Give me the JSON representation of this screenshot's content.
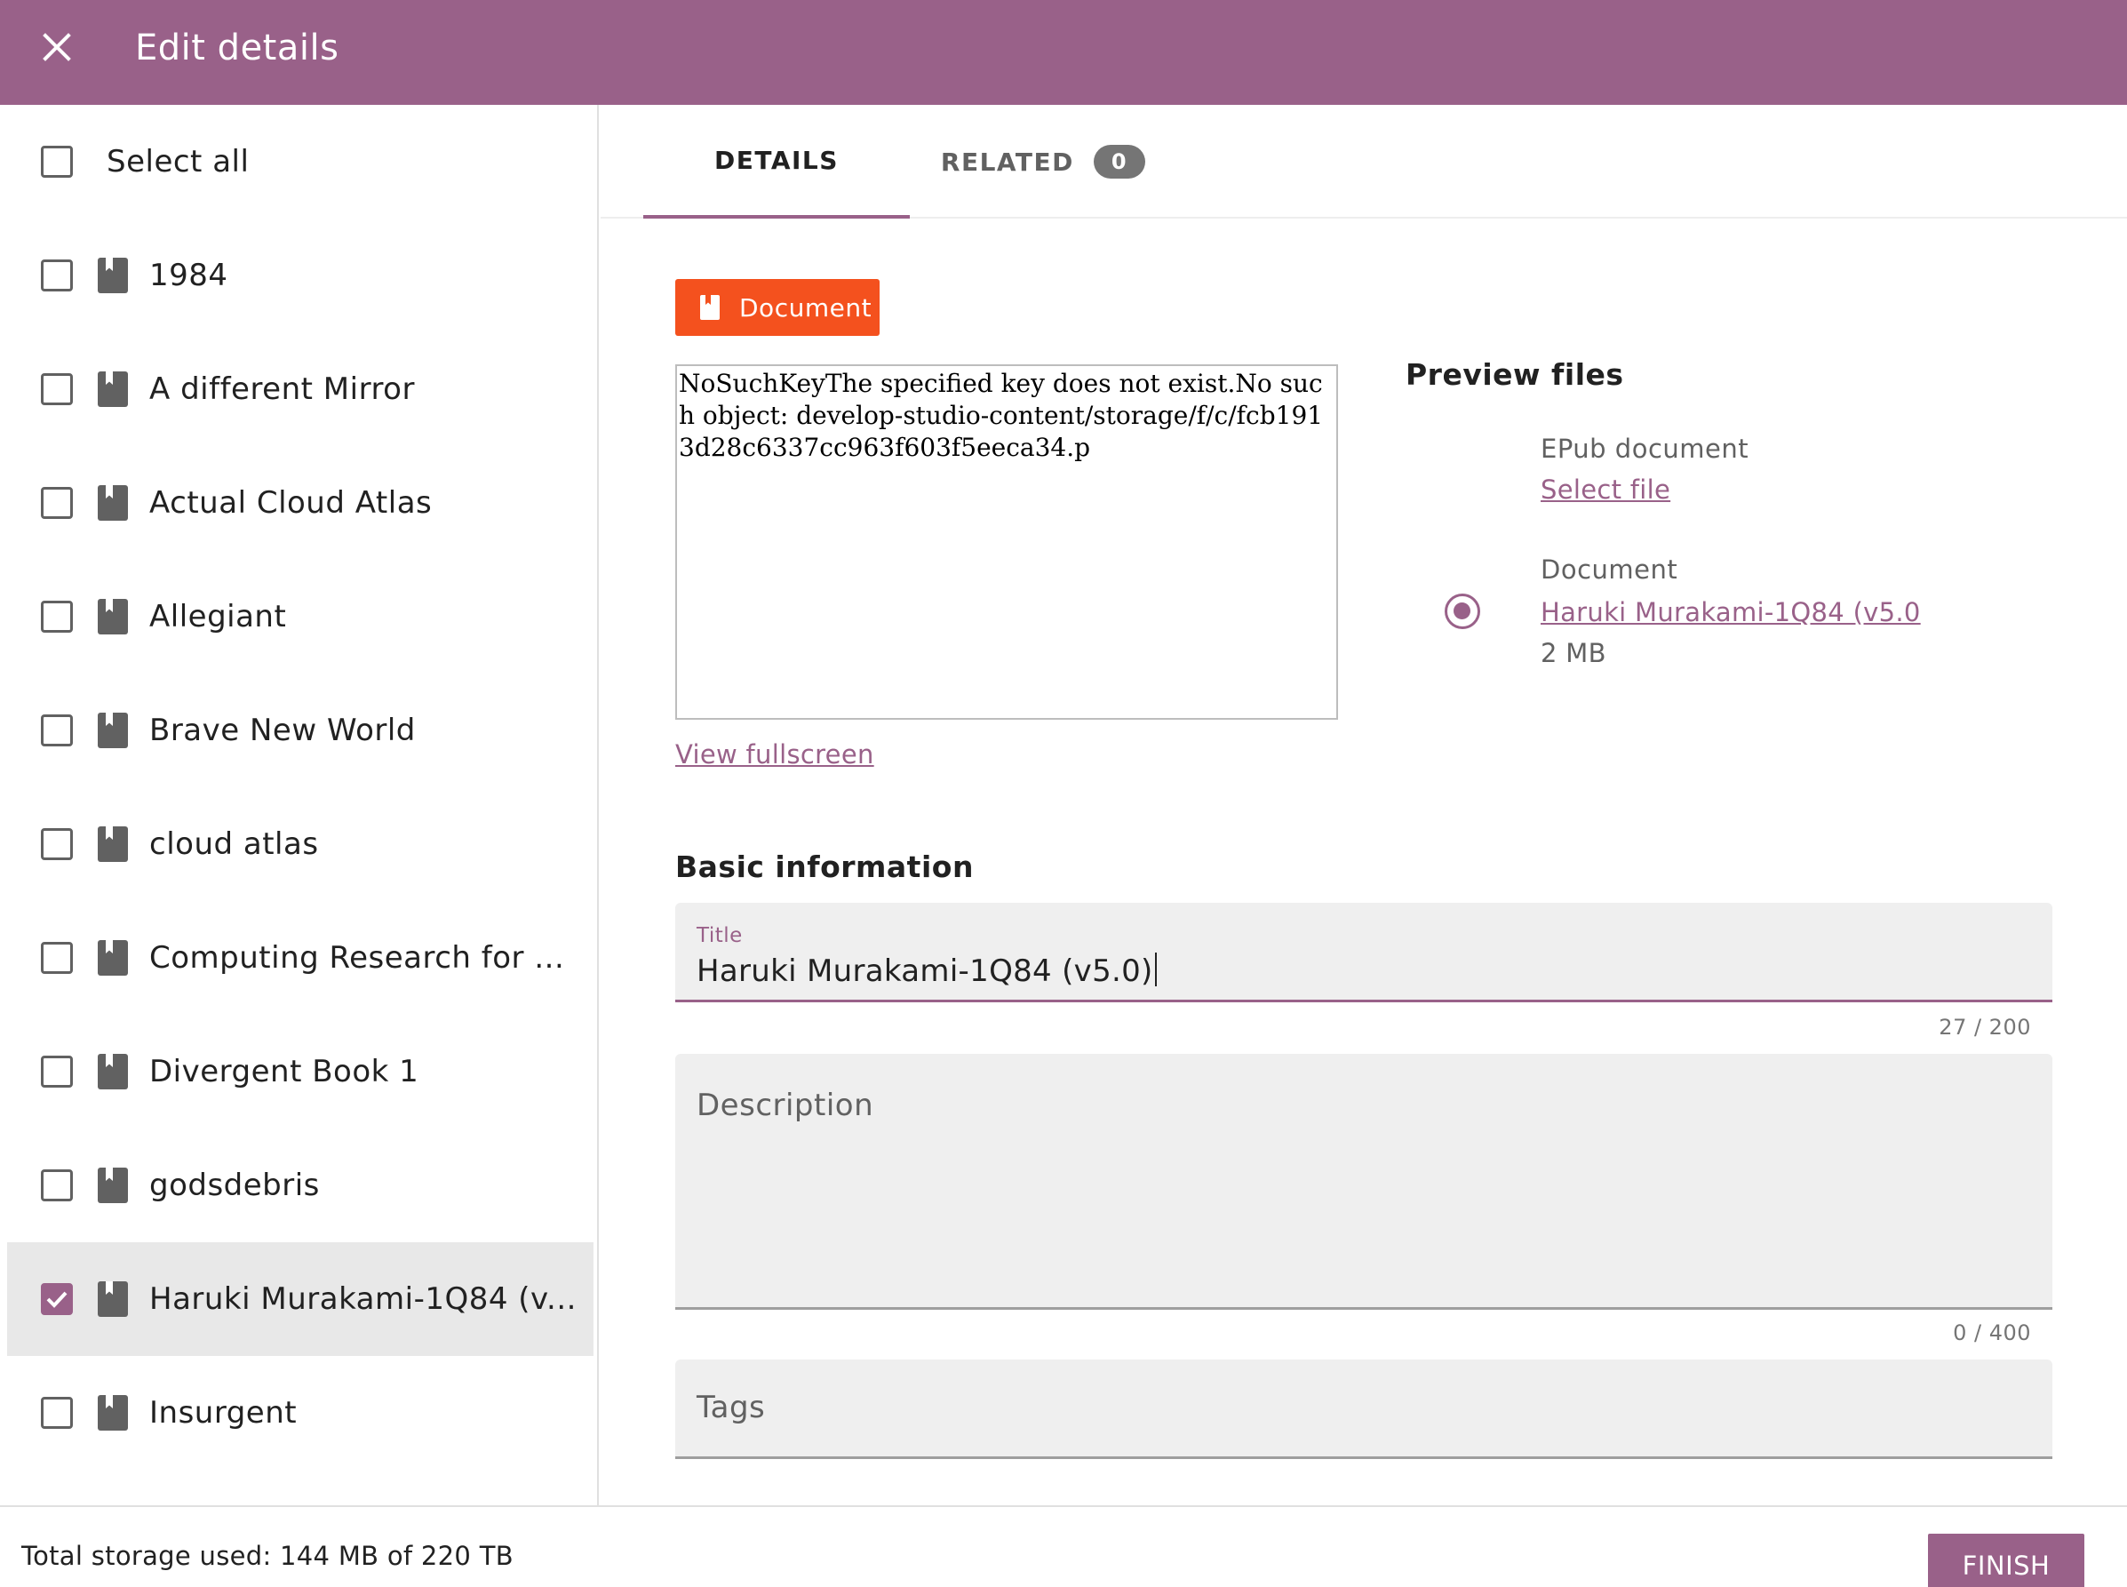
{
  "header": {
    "title": "Edit details",
    "background": "#996189"
  },
  "left_panel": {
    "select_all_label": "Select all",
    "items": [
      {
        "label": "1984",
        "checked": false
      },
      {
        "label": "A different Mirror",
        "checked": false
      },
      {
        "label": "Actual Cloud Atlas",
        "checked": false
      },
      {
        "label": "Allegiant",
        "checked": false
      },
      {
        "label": "Brave New World",
        "checked": false
      },
      {
        "label": "cloud atlas",
        "checked": false
      },
      {
        "label": "Computing Research for ...",
        "checked": false
      },
      {
        "label": "Divergent Book 1",
        "checked": false
      },
      {
        "label": "godsdebris",
        "checked": false
      },
      {
        "label": "Haruki Murakami-1Q84 (v...",
        "checked": true
      },
      {
        "label": "Insurgent",
        "checked": false
      }
    ]
  },
  "tabs": {
    "details": "DETAILS",
    "related": "RELATED",
    "related_count": "0"
  },
  "kind_chip": {
    "label": "Document",
    "color": "#f4511e"
  },
  "preview": {
    "frame_text": "NoSuchKeyThe specified key does not exist.No such object: develop-studio-content/storage/f/c/fcb1913d28c6337cc963f603f5eeca34.p",
    "view_fullscreen": "View fullscreen"
  },
  "preview_files": {
    "heading": "Preview files",
    "epub": {
      "kind": "EPub document",
      "link": "Select file"
    },
    "document": {
      "kind": "Document",
      "link": "Haruki Murakami-1Q84 (v5.0",
      "size": "2 MB",
      "selected": true
    }
  },
  "basic_info": {
    "heading": "Basic information",
    "title_label": "Title",
    "title_value": "Haruki Murakami-1Q84 (v5.0)",
    "title_counter": "27 / 200",
    "description_placeholder": "Description",
    "description_counter": "0 / 400",
    "tags_placeholder": "Tags"
  },
  "footer": {
    "storage": "Total storage used: 144 MB of 220 TB",
    "finish": "FINISH"
  },
  "icons": {
    "close": "close-icon",
    "document": "document-icon",
    "check": "check-icon"
  }
}
